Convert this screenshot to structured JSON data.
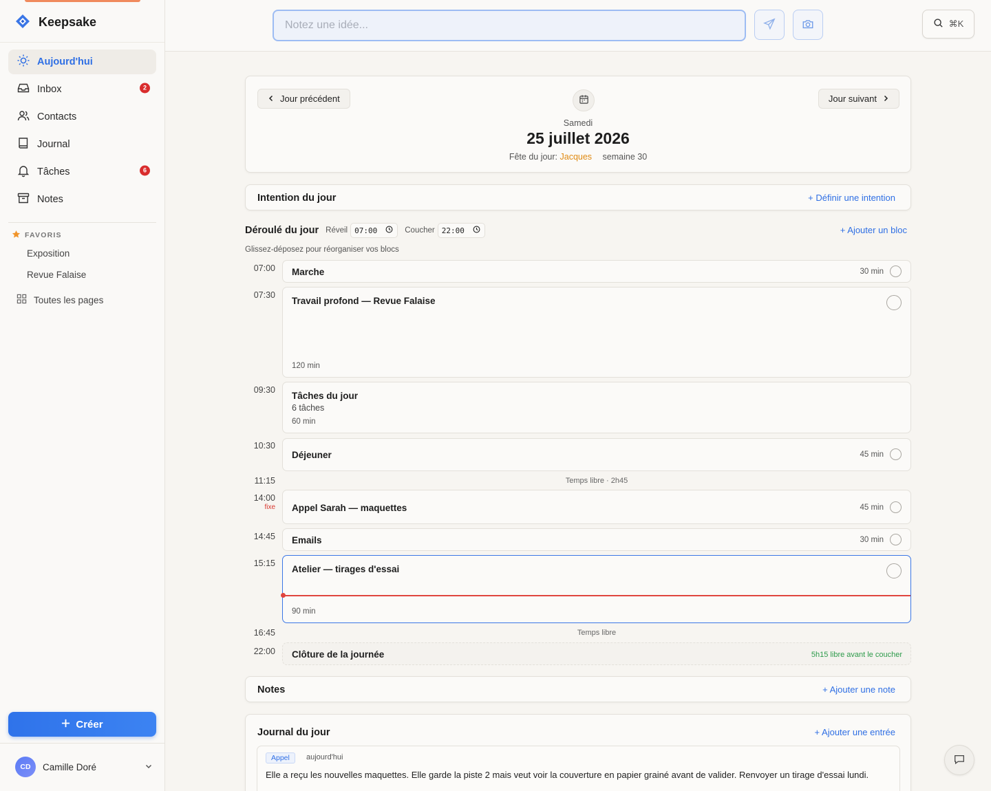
{
  "app": {
    "name": "Keepsake"
  },
  "sidebar": {
    "items": [
      {
        "label": "Aujourd'hui",
        "icon": "sun-icon",
        "active": true
      },
      {
        "label": "Inbox",
        "icon": "inbox-icon",
        "badge": "2"
      },
      {
        "label": "Contacts",
        "icon": "contacts-icon"
      },
      {
        "label": "Journal",
        "icon": "book-icon"
      },
      {
        "label": "Tâches",
        "icon": "bell-icon",
        "badge": "6"
      },
      {
        "label": "Notes",
        "icon": "archive-icon"
      }
    ],
    "favorites_heading": "FAVORIS",
    "favorites": [
      "Exposition",
      "Revue Falaise"
    ],
    "all_pages": "Toutes les pages",
    "create_label": "Créer",
    "user": {
      "initials": "CD",
      "name": "Camille Doré"
    }
  },
  "topbar": {
    "quick_placeholder": "Notez une idée...",
    "search_shortcut": "⌘K"
  },
  "day": {
    "prev_label": "Jour précédent",
    "next_label": "Jour suivant",
    "weekday": "Samedi",
    "date": "25 juillet 2026",
    "feast_prefix": "Fête du jour:",
    "feast_name": "Jacques",
    "week": "semaine 30"
  },
  "intention": {
    "title": "Intention du jour",
    "action": "+ Définir une intention"
  },
  "flow": {
    "title": "Déroulé du jour",
    "wake_label": "Réveil",
    "wake_time": "07:00",
    "bed_label": "Coucher",
    "bed_time": "22:00",
    "add_block": "+ Ajouter un bloc",
    "hint": "Glissez-déposez pour réorganiser vos blocs",
    "times": [
      "07:00",
      "07:30",
      "09:30",
      "10:30",
      "11:15",
      "14:00",
      "14:45",
      "15:15",
      "16:45",
      "22:00"
    ],
    "fixed_label": "fixe",
    "blocks": [
      {
        "title": "Marche",
        "duration": "30 min"
      },
      {
        "title": "Travail profond — Revue Falaise",
        "duration": "120 min"
      },
      {
        "title": "Tâches du jour",
        "subtitle": "6 tâches",
        "duration": "60 min"
      },
      {
        "title": "Déjeuner",
        "duration": "45 min"
      },
      {
        "title": "Appel Sarah — maquettes",
        "duration": "45 min"
      },
      {
        "title": "Emails",
        "duration": "30 min"
      },
      {
        "title": "Atelier — tirages d'essai",
        "duration": "90 min"
      }
    ],
    "free_1": "Temps libre · 2h45",
    "free_2": "Temps libre",
    "closing": {
      "title": "Clôture de la journée",
      "note": "5h15 libre avant le coucher"
    }
  },
  "notes": {
    "title": "Notes",
    "action": "+ Ajouter une note"
  },
  "journal": {
    "title": "Journal du jour",
    "action": "+ Ajouter une entrée",
    "entry": {
      "tag": "Appel",
      "when": "aujourd'hui",
      "text": "Elle a reçu les nouvelles maquettes. Elle garde la piste 2 mais veut voir la couverture en papier grainé avant de valider. Renvoyer un tirage d'essai lundi."
    }
  },
  "colors": {
    "accent": "#2f6fe4",
    "danger": "#d92d2d",
    "now": "#e0453e",
    "feast": "#e08a12",
    "ok": "#2c9a4a"
  }
}
